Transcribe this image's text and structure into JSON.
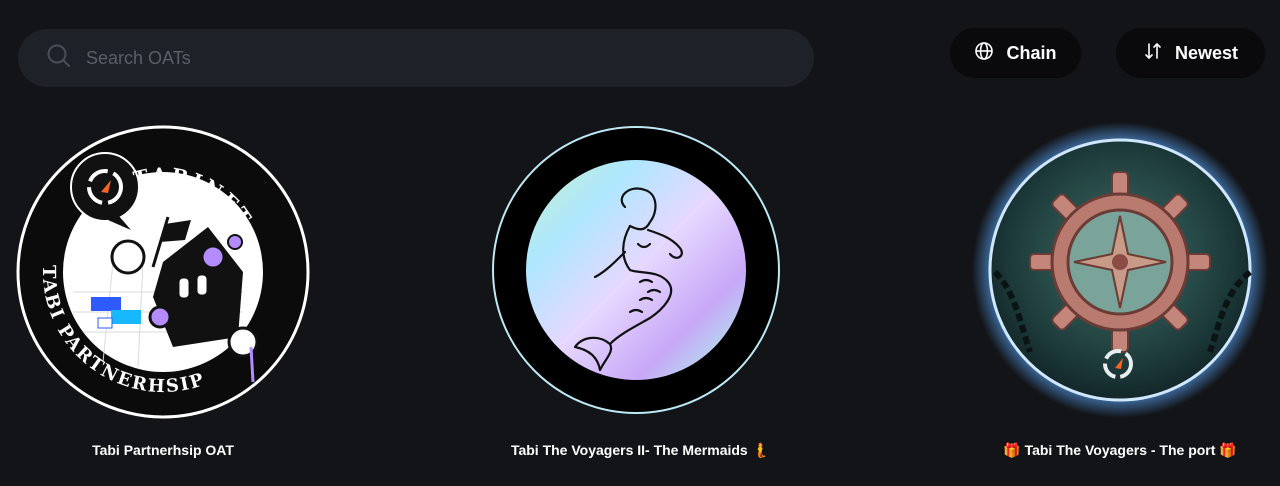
{
  "search": {
    "placeholder": "Search OATs"
  },
  "filters": {
    "chain_label": "Chain",
    "sort_label": "Newest"
  },
  "cards": [
    {
      "title": "Tabi Partnerhsip OAT",
      "ring_text_top": "TABINFT",
      "ring_text_bottom": "TABI PARTNERHSIP"
    },
    {
      "title": "Tabi The Voyagers II- The Mermaids 🧜"
    },
    {
      "title": "🎁 Tabi The Voyagers - The port 🎁"
    }
  ],
  "colors": {
    "background": "#131417",
    "search_bg": "#1f2129",
    "pill_bg": "#0a0a0c",
    "accent_orange": "#f26522",
    "glow_blue": "#5aa9ff"
  }
}
